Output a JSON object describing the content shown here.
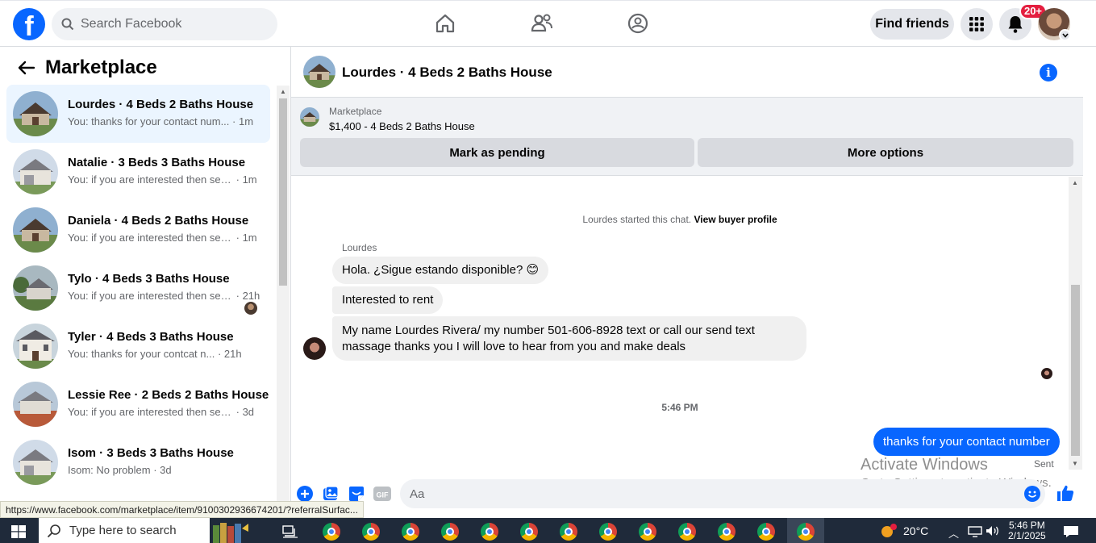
{
  "header": {
    "logo_letter": "f",
    "search_placeholder": "Search Facebook",
    "find_friends": "Find friends",
    "notif_badge": "20+"
  },
  "left": {
    "title": "Marketplace",
    "conversations": [
      {
        "title": "Lourdes · 4 Beds 2 Baths House",
        "msg": "You: thanks for your contact num...",
        "time": "· 1m",
        "active": true
      },
      {
        "title": "Natalie · 3 Beds 3 Baths House",
        "msg": "You: if you are interested then sen...",
        "time": "· 1m"
      },
      {
        "title": "Daniela · 4 Beds 2 Baths House",
        "msg": "You: if you are interested then sen...",
        "time": "· 1m"
      },
      {
        "title": "Tylo · 4 Beds 3 Baths House",
        "msg": "You: if you are interested then sen...",
        "time": "· 21h"
      },
      {
        "title": "Tyler · 4 Beds 3 Baths House",
        "msg": "You: thanks for your contcat n...",
        "time": "· 21h"
      },
      {
        "title": "Lessie Ree · 2 Beds 2 Baths House",
        "msg": "You: if you are interested then sen...",
        "time": "· 3d"
      },
      {
        "title": "Isom · 3 Beds 3 Baths House",
        "msg": "Isom: No problem",
        "time": "· 3d"
      }
    ]
  },
  "chat": {
    "title": "Lourdes · 4 Beds 2 Baths House",
    "listing_label": "Marketplace",
    "listing_price": "$1,400 - 4 Beds 2 Baths House",
    "mark_pending": "Mark as pending",
    "more_options": "More options",
    "started_text": "Lourdes started this chat.",
    "view_profile": "View buyer profile",
    "sender": "Lourdes",
    "messages": [
      "Hola. ¿Sigue estando disponible? 😊",
      "Interested to rent",
      "My name Lourdes Rivera/ my number 501-606-8928 text or call our send text massage thanks you I will love to hear from you and make deals"
    ],
    "time_separator": "5:46 PM",
    "my_message": "thanks for your contact number",
    "sent_label": "Sent",
    "composer_placeholder": "Aa"
  },
  "watermark": {
    "line1": "Activate Windows",
    "line2": "Go to Settings to activate Windows."
  },
  "status_link": "https://www.facebook.com/marketplace/item/9100302936674201/?referralSurfac...",
  "taskbar": {
    "search_placeholder": "Type here to search",
    "temperature": "20°C",
    "time": "5:46 PM",
    "date": "2/1/2025"
  },
  "colors": {
    "brand": "#0866ff",
    "badge": "#e41e3f",
    "active_row": "#ebf5ff"
  }
}
